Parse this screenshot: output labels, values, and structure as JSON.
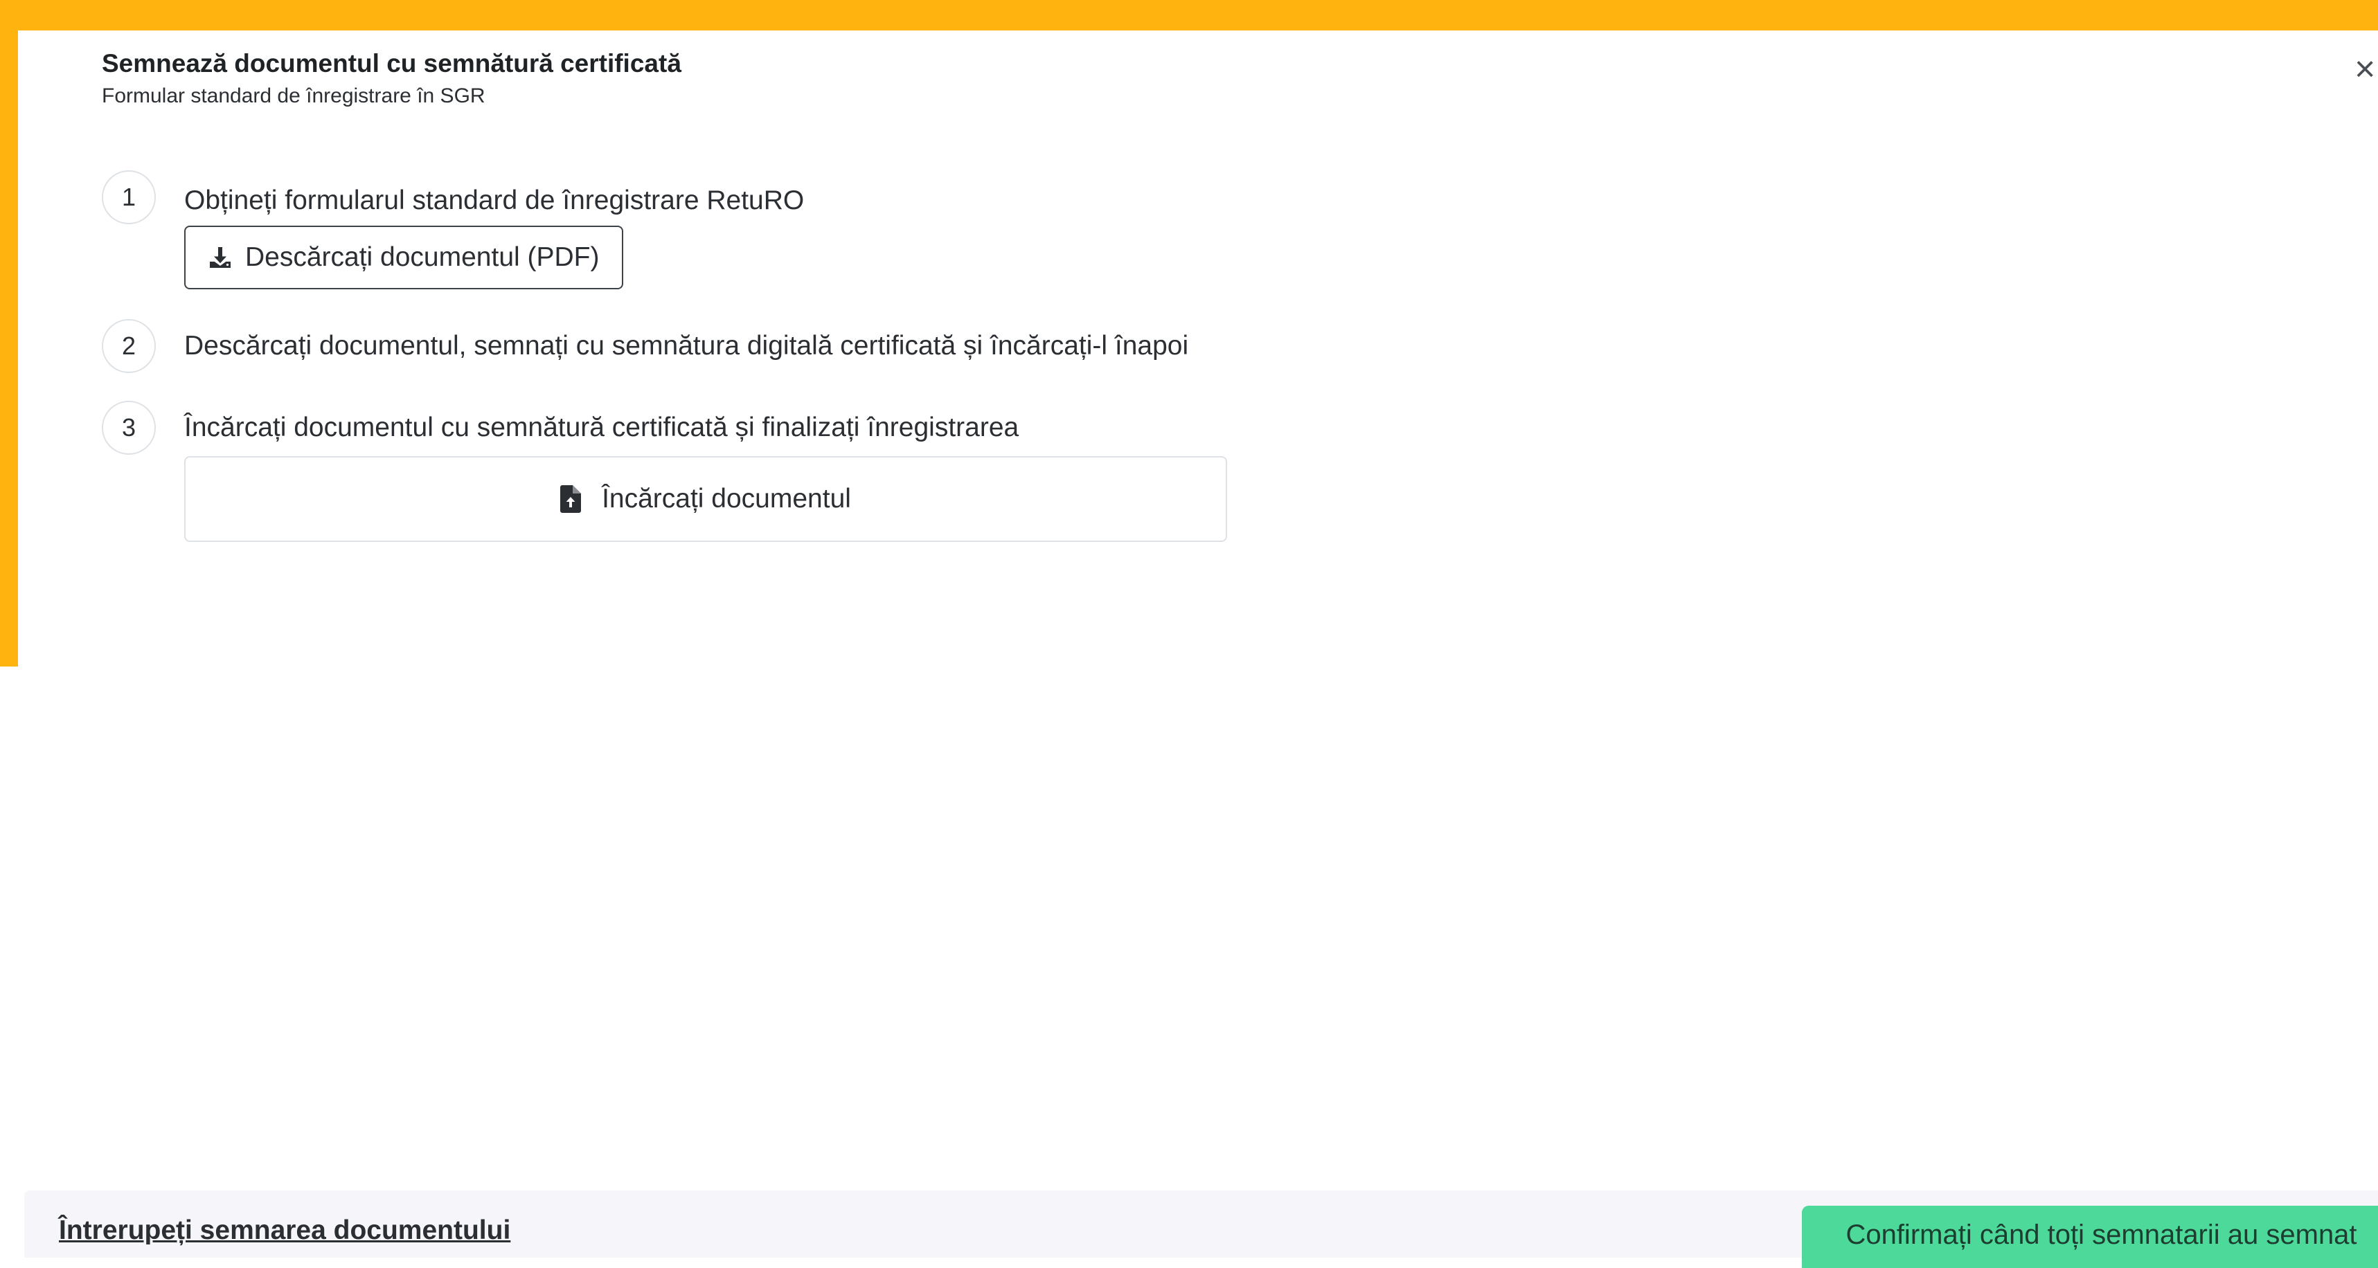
{
  "dialog": {
    "title": "Semnează documentul cu semnătură certificată",
    "subtitle": "Formular standard de înregistrare în SGR",
    "close_glyph": "×"
  },
  "steps": [
    {
      "number": "1",
      "text": "Obțineți formularul standard de înregistrare RetuRO",
      "button_label": "Descărcați documentul (PDF)",
      "button_icon": "download-icon"
    },
    {
      "number": "2",
      "text": "Descărcați documentul, semnați cu semnătura digitală certificată și încărcați-l înapoi"
    },
    {
      "number": "3",
      "text": "Încărcați documentul cu semnătură certificată și finalizați înregistrarea",
      "button_label": "Încărcați documentul",
      "button_icon": "file-upload-icon"
    }
  ],
  "footer": {
    "abort_label": "Întrerupeți semnarea documentului",
    "confirm_label": "Confirmați când toți semnatarii au semnat"
  },
  "colors": {
    "accent_frame": "#FFB30F",
    "confirm_button": "#4DD99A",
    "footer_background": "#F5F5FA"
  }
}
